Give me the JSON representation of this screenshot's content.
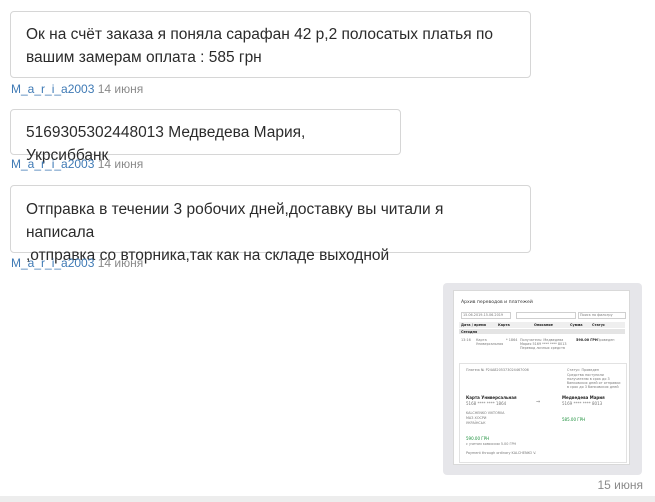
{
  "messages": [
    {
      "line1": "Ок на счёт заказа я поняла сарафан 42 р,2 полосатых платья по",
      "line2": "вашим замерам оплата : 585 грн",
      "author": "M_a_r_i_a2003",
      "date": "14 июня"
    },
    {
      "line1": "5169305302448013 Медведева Мария, Укрсиббанк",
      "author": "M_a_r_i_a2003",
      "date": "14 июня"
    },
    {
      "line1": "Отправка в течении 3 робочих дней,доставку вы читали я написала",
      "line2": ",отправка со вторника,так как на складе выходной",
      "author": "M_a_r_i_a2003",
      "date": "14 июня"
    }
  ],
  "outgoing": {
    "date": "15 июня",
    "screenshot": {
      "title": "Архив переводов и платежей",
      "date_range": "15.06.2019-15.06.2019",
      "search_placeholder": "Поиск по фильтру",
      "filter_btn": "Показать",
      "columns": [
        "Дата / время",
        "Карта",
        "Описание",
        "Сумма",
        "Статус"
      ],
      "group": "Сегодня",
      "row": {
        "time": "13:16",
        "card": "Карта Универсальная",
        "mask": "* 1864",
        "desc": "Получатель: Медведева Мария 5169 **** **** 8013 Перевод личных средств",
        "sum": "590.00 ГРН",
        "status": "Проведен"
      },
      "payment_id": "Платеж № P24A8205373024467006",
      "status_label": "Статус: Проведен",
      "status_note": "Средства поступили получателю в срок до 3 банковских дней от отправки в срок до 3 банковских дней",
      "from_card": "Карта Универсальная",
      "from_mask": "5168 **** **** 1864",
      "from_name": "KALCHENKO VIKTORIIA",
      "from_line2": "МАЗ ХОСРИ",
      "from_line3": "УКРАЇНСЬК",
      "to_name": "Медведева Мария",
      "to_mask": "5169 **** **** 8013",
      "to_sum": "585.00 ГРН",
      "total": "590.00 ГРН",
      "fee": "с учетом комиссии 5.00 ГРН",
      "footer": "Payment through ordinary KALCHENKO V."
    }
  }
}
